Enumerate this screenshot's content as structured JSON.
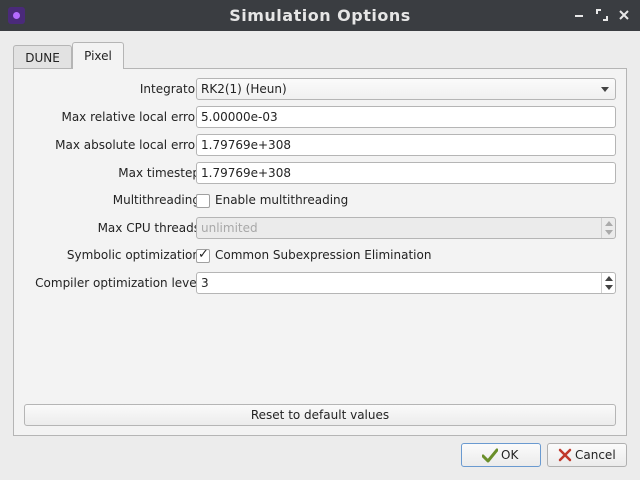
{
  "window": {
    "title": "Simulation Options"
  },
  "tabs": [
    {
      "label": "DUNE",
      "active": false
    },
    {
      "label": "Pixel",
      "active": true
    }
  ],
  "form": {
    "integrator": {
      "label": "Integrator",
      "value": "RK2(1) (Heun)"
    },
    "max_rel_error": {
      "label": "Max relative local error",
      "value": "5.00000e-03"
    },
    "max_abs_error": {
      "label": "Max absolute local error",
      "value": "1.79769e+308"
    },
    "max_timestep": {
      "label": "Max timestep",
      "value": "1.79769e+308"
    },
    "multithreading": {
      "label": "Multithreading",
      "checkbox_label": "Enable multithreading",
      "checked": false
    },
    "max_cpu_threads": {
      "label": "Max CPU threads",
      "value": "unlimited",
      "disabled": true
    },
    "symbolic_opt": {
      "label": "Symbolic optimization",
      "checkbox_label": "Common Subexpression Elimination",
      "checked": true,
      "tick": "✓"
    },
    "compiler_opt": {
      "label": "Compiler optimization level",
      "value": "3"
    }
  },
  "reset_button": {
    "label": "Reset to default values"
  },
  "dialog_buttons": {
    "ok": "OK",
    "cancel": "Cancel"
  },
  "colors": {
    "titlebar": "#3a3d41",
    "ok_icon": "#6a8f2a",
    "cancel_icon": "#c0392b",
    "ok_border": "#6a9ad0"
  }
}
